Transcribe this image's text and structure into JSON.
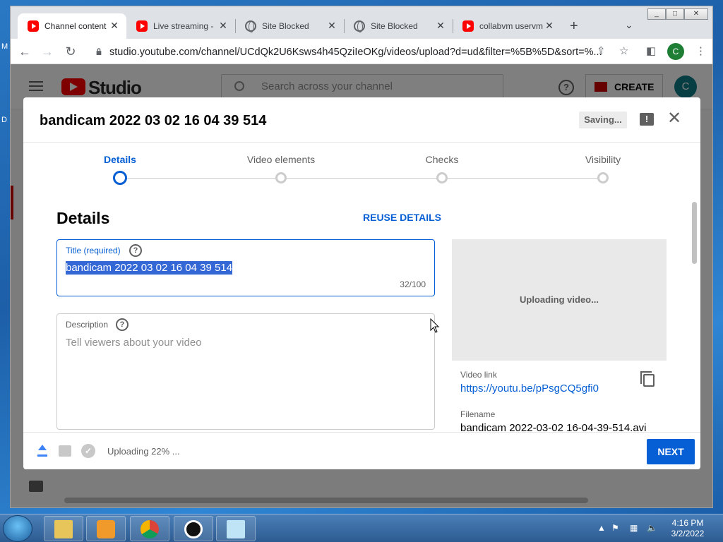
{
  "browser": {
    "tabs": [
      {
        "title": "Channel content",
        "favicon": "youtube-icon",
        "active": true
      },
      {
        "title": "Live streaming -",
        "favicon": "youtube-icon",
        "active": false
      },
      {
        "title": "Site Blocked",
        "favicon": "globe-icon",
        "active": false
      },
      {
        "title": "Site Blocked",
        "favicon": "globe-icon",
        "active": false
      },
      {
        "title": "collabvm uservm",
        "favicon": "youtube-icon",
        "active": false
      }
    ],
    "new_tab_label": "+",
    "address": "studio.youtube.com/channel/UCdQk2U6Ksws4h45QziIeOKg/videos/upload?d=ud&filter=%5B%5D&sort=%...",
    "profile_initial": "C"
  },
  "studio": {
    "logo_text": "Studio",
    "search_placeholder": "Search across your channel",
    "create_label": "CREATE",
    "avatar_initial": "C"
  },
  "dialog": {
    "title": "bandicam 2022 03 02 16 04 39 514",
    "saving_label": "Saving...",
    "steps": [
      {
        "label": "Details",
        "active": true
      },
      {
        "label": "Video elements",
        "active": false
      },
      {
        "label": "Checks",
        "active": false
      },
      {
        "label": "Visibility",
        "active": false
      }
    ],
    "section_heading": "Details",
    "reuse_label": "REUSE DETAILS",
    "title_field": {
      "label": "Title (required)",
      "value": "bandicam 2022 03 02 16 04 39 514",
      "char_count": "32/100"
    },
    "description_field": {
      "label": "Description",
      "placeholder": "Tell viewers about your video"
    },
    "preview": {
      "status_text": "Uploading video...",
      "video_link_label": "Video link",
      "video_link": "https://youtu.be/pPsgCQ5gfi0",
      "filename_label": "Filename",
      "filename": "bandicam 2022-03-02 16-04-39-514.avi"
    },
    "footer": {
      "upload_status": "Uploading 22% ...",
      "upload_progress": 0.22,
      "next_label": "NEXT"
    }
  },
  "taskbar": {
    "time": "4:16 PM",
    "date": "3/2/2022"
  },
  "colors": {
    "accent": "#065fd4",
    "youtube_red": "#ff0000"
  }
}
